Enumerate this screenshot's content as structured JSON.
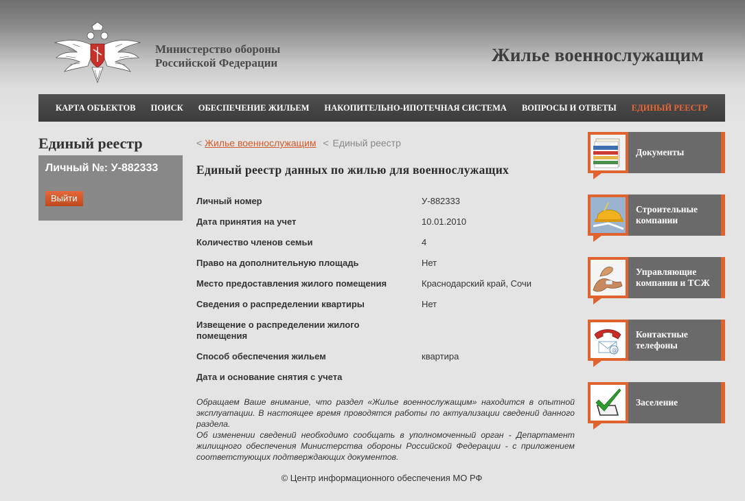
{
  "header": {
    "ministry_line1": "Министерство обороны",
    "ministry_line2": "Российской Федерации",
    "site_title": "Жилье военнослужащим"
  },
  "nav": [
    {
      "label": "Карта объектов",
      "active": false
    },
    {
      "label": "Поиск",
      "active": false
    },
    {
      "label": "Обеспечение жильем",
      "active": false
    },
    {
      "label": "Накопительно-ипотечная система",
      "active": false
    },
    {
      "label": "Вопросы и ответы",
      "active": false
    },
    {
      "label": "Единый реестр",
      "active": true
    }
  ],
  "left": {
    "title": "Единый реестр",
    "user_id": "Личный №: У-882333",
    "logout_label": "Выйти"
  },
  "breadcrumb": {
    "prefix": "<",
    "link": "Жилье военнослужащим",
    "separator": "<",
    "current": "Единый реестр"
  },
  "main": {
    "title": "Единый реестр данных по жилью для военнослужащих",
    "rows": [
      {
        "label": "Личный номер",
        "value": "У-882333"
      },
      {
        "label": "Дата принятия на учет",
        "value": "10.01.2010"
      },
      {
        "label": "Количество членов семьи",
        "value": "4"
      },
      {
        "label": "Право на дополнительную площадь",
        "value": "Нет"
      },
      {
        "label": "Место предоставления жилого помещения",
        "value": "Краснодарский край, Сочи"
      },
      {
        "label": "Сведения о распределении квартиры",
        "value": "Нет"
      },
      {
        "label": "Извещение о распределении жилого помещения",
        "value": ""
      },
      {
        "label": "Способ обеспечения жильем",
        "value": "квартира"
      },
      {
        "label": "Дата и основание снятия с учета",
        "value": ""
      }
    ],
    "notice_p1": "Обращаем Ваше внимание, что раздел «Жилье военнослужащим» находится в опытной эксплуатации. В настоящее время проводятся работы по актуализации сведений данного раздела.",
    "notice_p2": "Об изменении сведений необходимо сообщать в уполномоченный орган - Департамент жилищного обеспечения Министерства обороны Российской Федерации - с приложением соответстующих подтверждающих документов.",
    "footer": "© Центр информационного обеспечения МО РФ"
  },
  "sidebar": [
    {
      "label": "Документы",
      "icon": "documents-icon"
    },
    {
      "label": "Строительные компании",
      "icon": "construction-icon"
    },
    {
      "label": "Управляющие компании и ТСЖ",
      "icon": "management-icon"
    },
    {
      "label": "Контактные телефоны",
      "icon": "phone-icon"
    },
    {
      "label": "Заселение",
      "icon": "checkmark-icon"
    }
  ],
  "colors": {
    "accent": "#e0622f",
    "nav_bg": "#444444",
    "sidebar_bg": "#6a6a6a",
    "user_box_bg": "#888888"
  }
}
